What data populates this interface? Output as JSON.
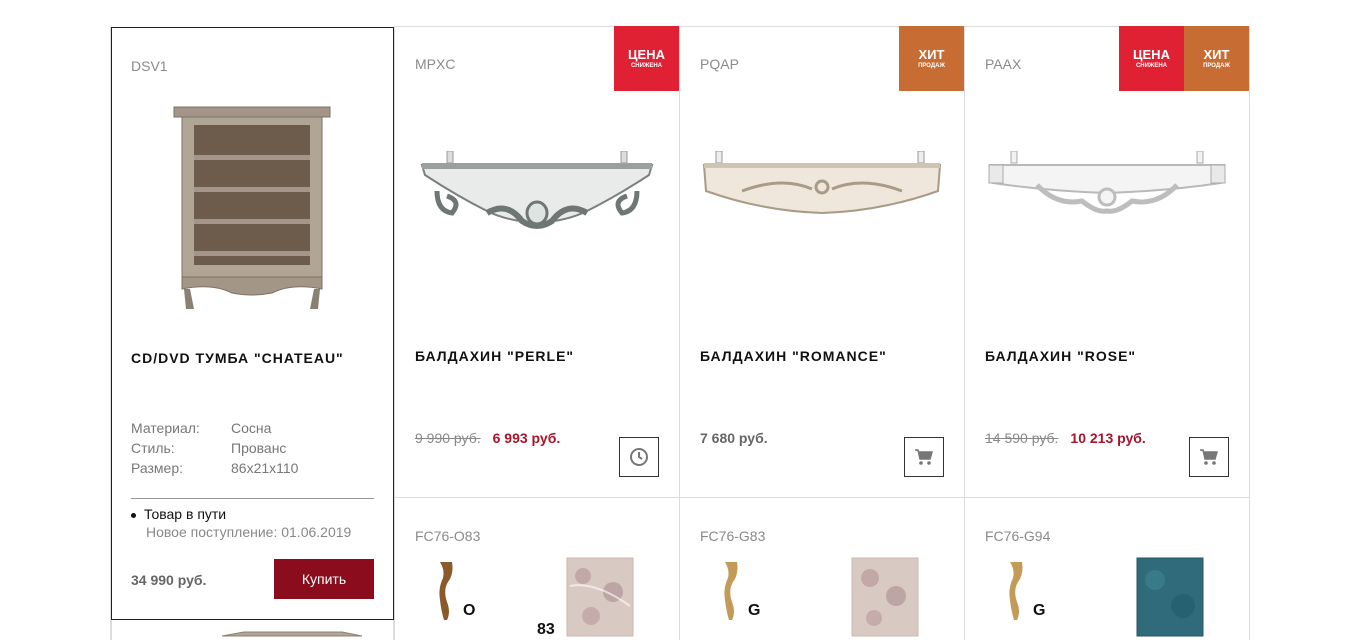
{
  "featured": {
    "sku": "DSV1",
    "name": "CD/DVD ТУМБА \"CHATEAU\"",
    "props": [
      {
        "key": "Материал:",
        "value": "Сосна"
      },
      {
        "key": "Стиль:",
        "value": "Прованс"
      },
      {
        "key": "Размер:",
        "value": "86x21x110"
      }
    ],
    "status_title": "Товар в пути",
    "status_note": "Новое поступление: 01.06.2019",
    "price": "34 990 руб.",
    "buy_label": "Купить"
  },
  "products": [
    {
      "sku": "MPXC",
      "name": "БАЛДАХИН \"PERLE\"",
      "old_price": "9 990 руб.",
      "new_price": "6 993 руб.",
      "action_icon": "clock-icon",
      "badges": [
        {
          "line1": "ЦЕНА",
          "line2": "СНИЖЕНА",
          "color": "#e02134"
        }
      ]
    },
    {
      "sku": "PQAP",
      "name": "БАЛДАХИН \"ROMANCE\"",
      "price": "7 680 руб.",
      "action_icon": "cart-icon",
      "badges": [
        {
          "line1": "ХИТ",
          "line2": "ПРОДАЖ",
          "color": "#c76c33"
        }
      ]
    },
    {
      "sku": "PAAX",
      "name": "БАЛДАХИН \"ROSE\"",
      "old_price": "14 590 руб.",
      "new_price": "10 213 руб.",
      "action_icon": "cart-icon",
      "badges": [
        {
          "line1": "ЦЕНА",
          "line2": "СНИЖЕНА",
          "color": "#e02134"
        },
        {
          "line1": "ХИТ",
          "line2": "ПРОДАЖ",
          "color": "#c76c33"
        }
      ]
    }
  ],
  "tiles": [
    {
      "sku": "FC76-O83",
      "leg_letter": "O",
      "swatch_number": "83",
      "swatch_color": "#d9c9c3"
    },
    {
      "sku": "FC76-G83",
      "leg_letter": "G",
      "swatch_number": "",
      "swatch_color": "#d9c9c3"
    },
    {
      "sku": "FC76-G94",
      "leg_letter": "G",
      "swatch_number": "",
      "swatch_color": "#2f6b7a"
    }
  ]
}
